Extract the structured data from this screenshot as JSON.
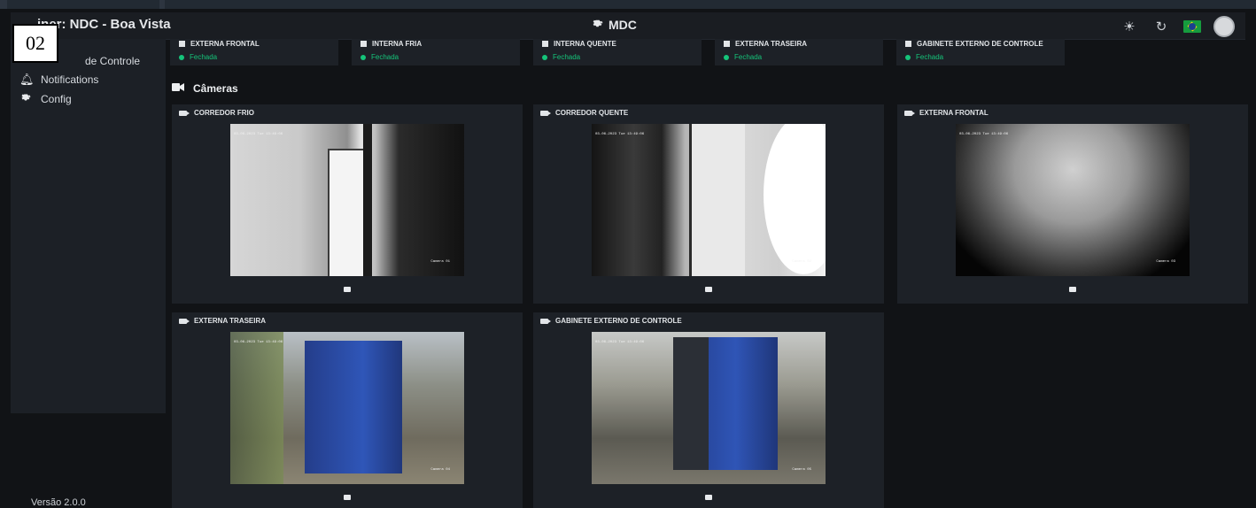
{
  "badge": "02",
  "topbar": {
    "title": "iner: NDC - Boa Vista",
    "center_icon": "gear-icon",
    "center_label": "MDC",
    "icons": [
      "sun-icon",
      "refresh-icon",
      "brazil-flag-icon",
      "avatar"
    ]
  },
  "sidebar": {
    "items": [
      {
        "label": "de Controle",
        "icon": ""
      },
      {
        "label": "Notifications",
        "icon": "bell-icon"
      },
      {
        "label": "Config",
        "icon": "gear-icon"
      }
    ],
    "version": "Versão 2.0.0"
  },
  "doors": [
    {
      "name": "EXTERNA FRONTAL",
      "status": "Fechada"
    },
    {
      "name": "INTERNA FRIA",
      "status": "Fechada"
    },
    {
      "name": "INTERNA QUENTE",
      "status": "Fechada"
    },
    {
      "name": "EXTERNA TRASEIRA",
      "status": "Fechada"
    },
    {
      "name": "GABINETE EXTERNO DE CONTROLE",
      "status": "Fechada"
    }
  ],
  "cameras_header": "Câmeras",
  "cameras": [
    {
      "name": "CORREDOR FRIO",
      "timestamp": "03-06-2023 Tue 13:49:06",
      "label": "Camera 01"
    },
    {
      "name": "CORREDOR QUENTE",
      "timestamp": "03-06-2023 Tue 13:49:06",
      "label": "Camera 02"
    },
    {
      "name": "EXTERNA FRONTAL",
      "timestamp": "03-06-2023 Tue 13:49:06",
      "label": "Camera 03"
    },
    {
      "name": "EXTERNA TRASEIRA",
      "timestamp": "03-06-2023 Tue 13:49:06",
      "label": "Camera 04"
    },
    {
      "name": "GABINETE EXTERNO DE CONTROLE",
      "timestamp": "03-06-2023 Tue 13:49:06",
      "label": "Camera 05"
    }
  ],
  "colors": {
    "status_green": "#15c47a",
    "background": "#111316",
    "card": "#1d2127"
  }
}
